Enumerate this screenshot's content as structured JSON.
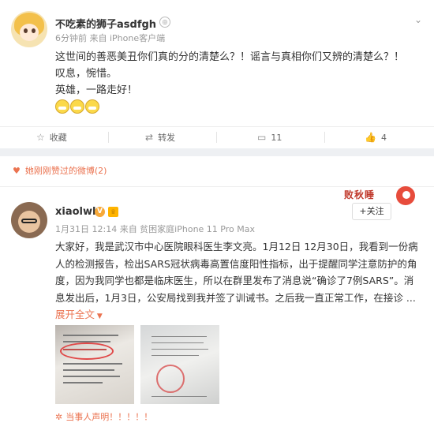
{
  "post1": {
    "username": "不吃素的狮子asdfgh",
    "meta": "6分钟前 来自 iPhone客户端",
    "lines": [
      "这世间的善恶美丑你们真的分的清楚么？！谣言与真相你们又辨的清楚么？！",
      "叹息，惋惜。",
      "英雄，一路走好！"
    ],
    "actions": {
      "favorite": "收藏",
      "repost": "转发",
      "comments": "11",
      "likes": "4"
    }
  },
  "liked_notice": "她刚刚赞过的微博(2)",
  "post2": {
    "username": "xiaolwl",
    "meta": "1月31日 12:14 来自 贫困家庭iPhone 11 Pro Max",
    "follow_label": "+关注",
    "sticker_text": "败秋睡",
    "content": "大家好，我是武汉市中心医院眼科医生李文亮。1月12日 12月30日，我看到一份病人的检测报告，检出SARS冠状病毒高置信度阳性指标，出于提醒同学注意防护的角度，因为我同学也都是临床医生，所以在群里发布了消息说“确诊了7例SARS”。消息发出后，1月3日，公安局找到我并签了训诫书。之后我一直正常工作，在接诊 ...",
    "expand_label": "展开全文",
    "statement": "当事人声明！！！！！"
  }
}
